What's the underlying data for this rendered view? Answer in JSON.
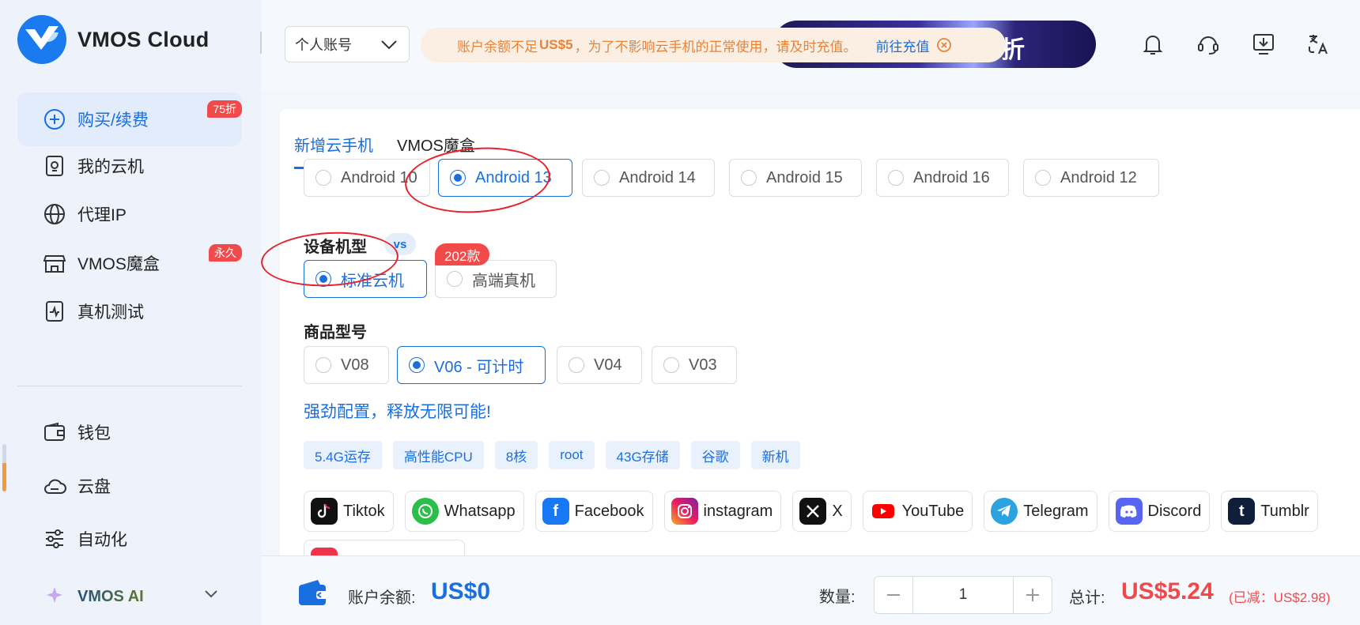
{
  "app": {
    "name": "VMOS Cloud"
  },
  "sidebar": {
    "items": [
      {
        "label": "购买/续费",
        "badge": "75折",
        "icon": "plus-circle-icon"
      },
      {
        "label": "我的云机",
        "icon": "cloud-phone-icon"
      },
      {
        "label": "代理IP",
        "icon": "globe-icon"
      },
      {
        "label": "VMOS魔盒",
        "badge": "永久",
        "icon": "store-icon"
      },
      {
        "label": "真机测试",
        "icon": "pulse-icon"
      },
      {
        "label": "钱包",
        "icon": "wallet-icon"
      },
      {
        "label": "云盘",
        "icon": "cloud-icon"
      },
      {
        "label": "自动化",
        "icon": "sliders-icon"
      }
    ],
    "ai_label": "VMOS AI"
  },
  "topbar": {
    "account_select": "个人账号",
    "notice": {
      "prefix": "账户余额不足",
      "amount": "US$5",
      "suffix": "，为了不影响云手机的正常使用，请及时充值。",
      "link": "前往充值"
    },
    "promo_text": "5折"
  },
  "tabs": [
    {
      "label": "新增云手机",
      "active": true
    },
    {
      "label": "VMOS魔盒",
      "active": false
    }
  ],
  "android_versions": [
    {
      "label": "Android 10",
      "selected": false
    },
    {
      "label": "Android 13",
      "selected": true
    },
    {
      "label": "Android 14",
      "selected": false
    },
    {
      "label": "Android 15",
      "selected": false
    },
    {
      "label": "Android 16",
      "selected": false
    },
    {
      "label": "Android 12",
      "selected": false
    }
  ],
  "device_model": {
    "title": "设备机型",
    "vs": "vs",
    "count_badge": "202款",
    "options": [
      {
        "label": "标准云机",
        "selected": true
      },
      {
        "label": "高端真机",
        "selected": false
      }
    ]
  },
  "product_model": {
    "title": "商品型号",
    "options": [
      {
        "label": "V08",
        "selected": false
      },
      {
        "label": "V06 - 可计时",
        "selected": true
      },
      {
        "label": "V04",
        "selected": false
      },
      {
        "label": "V03",
        "selected": false
      }
    ]
  },
  "highlight": "强劲配置，释放无限可能!",
  "tags": [
    "5.4G运存",
    "高性能CPU",
    "8核",
    "root",
    "43G存储",
    "谷歌",
    "新机"
  ],
  "apps": [
    {
      "label": "Tiktok",
      "icon": "tiktok-icon",
      "color": "#111111"
    },
    {
      "label": "Whatsapp",
      "icon": "whatsapp-icon",
      "color": "#2bbf4a"
    },
    {
      "label": "Facebook",
      "icon": "facebook-icon",
      "color": "#1877f2"
    },
    {
      "label": "instagram",
      "icon": "instagram-icon",
      "color": "#d62f8a"
    },
    {
      "label": "X",
      "icon": "x-icon",
      "color": "#111111"
    },
    {
      "label": "YouTube",
      "icon": "youtube-icon",
      "color": "#ff0000"
    },
    {
      "label": "Telegram",
      "icon": "telegram-icon",
      "color": "#2aa3e0"
    },
    {
      "label": "Discord",
      "icon": "discord-icon",
      "color": "#5865f2"
    },
    {
      "label": "Tumblr",
      "icon": "tumblr-icon",
      "color": "#0f1f3a"
    }
  ],
  "bottom": {
    "balance_label": "账户余额:",
    "balance_value": "US$0",
    "quantity_label": "数量:",
    "quantity": "1",
    "total_label": "总计:",
    "total_value": "US$5.24",
    "discount": "(已减：US$2.98)"
  },
  "colors": {
    "accent": "#1a6fe0",
    "danger": "#f0494a",
    "notice_text": "#e8843a"
  }
}
